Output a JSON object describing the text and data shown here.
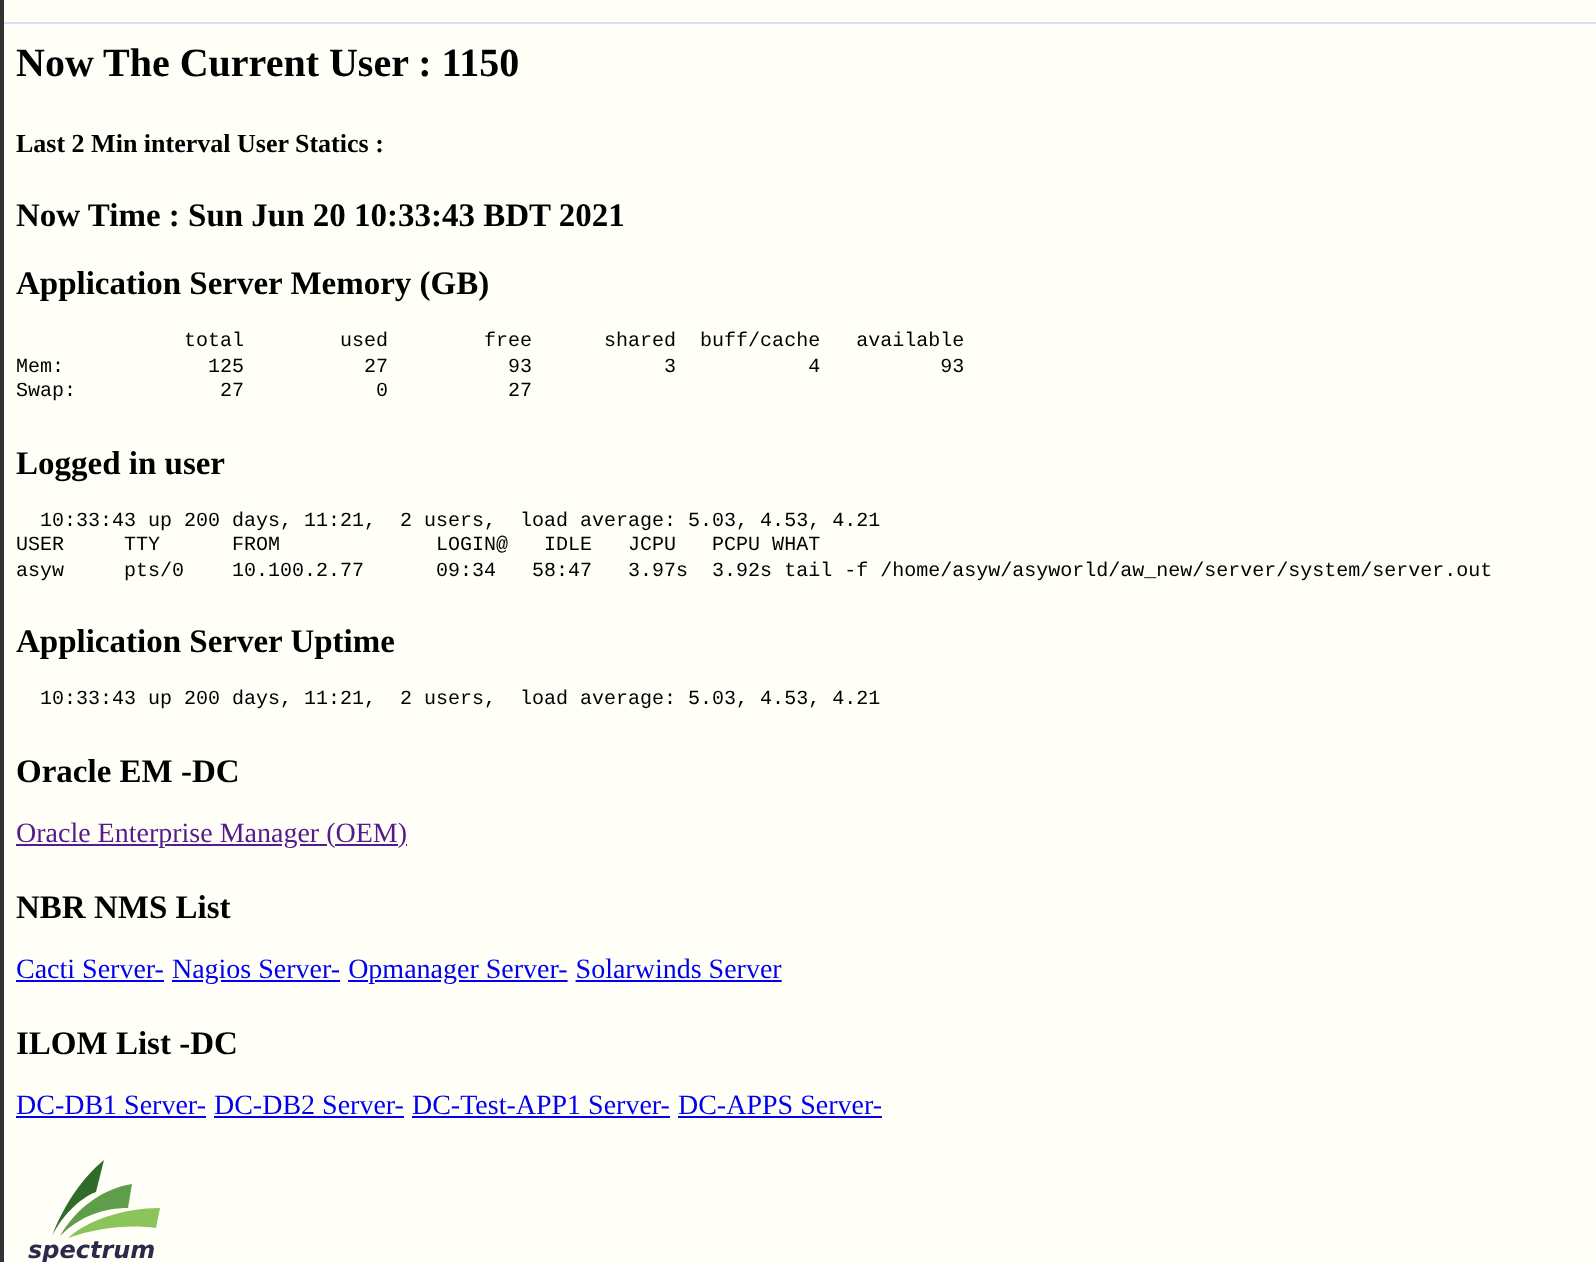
{
  "blocks": [
    {
      "kind": "title",
      "text": "Now The Current User : 1150"
    },
    {
      "kind": "note",
      "text": "Last 2 Min interval User Statics :"
    },
    {
      "kind": "heading",
      "text": "Now Time : Sun Jun 20 10:33:43 BDT 2021"
    },
    {
      "kind": "heading",
      "text": "Application Server Memory (GB)"
    },
    {
      "kind": "output",
      "lines": [
        "              total        used        free      shared  buff/cache   available",
        "Mem:            125          27          93           3           4          93",
        "Swap:            27           0          27"
      ]
    },
    {
      "kind": "heading",
      "text": "Logged in user"
    },
    {
      "kind": "output",
      "lines": [
        "  10:33:43 up 200 days, 11:21,  2 users,  load average: 5.03, 4.53, 4.21",
        "USER     TTY      FROM             LOGIN@   IDLE   JCPU   PCPU WHAT",
        "asyw     pts/0    10.100.2.77      09:34   58:47   3.97s  3.92s tail -f /home/asyw/asyworld/aw_new/server/system/server.out"
      ]
    },
    {
      "kind": "heading",
      "text": "Application Server Uptime"
    },
    {
      "kind": "output",
      "lines": [
        "  10:33:43 up 200 days, 11:21,  2 users,  load average: 5.03, 4.53, 4.21"
      ]
    },
    {
      "kind": "heading",
      "text": "Oracle EM -DC"
    },
    {
      "kind": "links",
      "links": [
        {
          "text": "Oracle Enterprise Manager (OEM)",
          "visited": true
        }
      ]
    },
    {
      "kind": "heading",
      "text": "NBR NMS List"
    },
    {
      "kind": "links",
      "links": [
        {
          "text": "Cacti Server-",
          "visited": false
        },
        {
          "text": "Nagios Server-",
          "visited": false
        },
        {
          "text": "Opmanager Server-",
          "visited": false
        },
        {
          "text": "Solarwinds Server",
          "visited": false
        }
      ]
    },
    {
      "kind": "heading",
      "text": "ILOM List -DC"
    },
    {
      "kind": "links",
      "links": [
        {
          "text": "DC-DB1 Server-",
          "visited": false
        },
        {
          "text": "DC-DB2 Server-",
          "visited": false
        },
        {
          "text": "DC-Test-APP1 Server-",
          "visited": false
        },
        {
          "text": "DC-APPS Server-",
          "visited": false
        }
      ]
    }
  ],
  "logo": {
    "text": "spectrum"
  }
}
